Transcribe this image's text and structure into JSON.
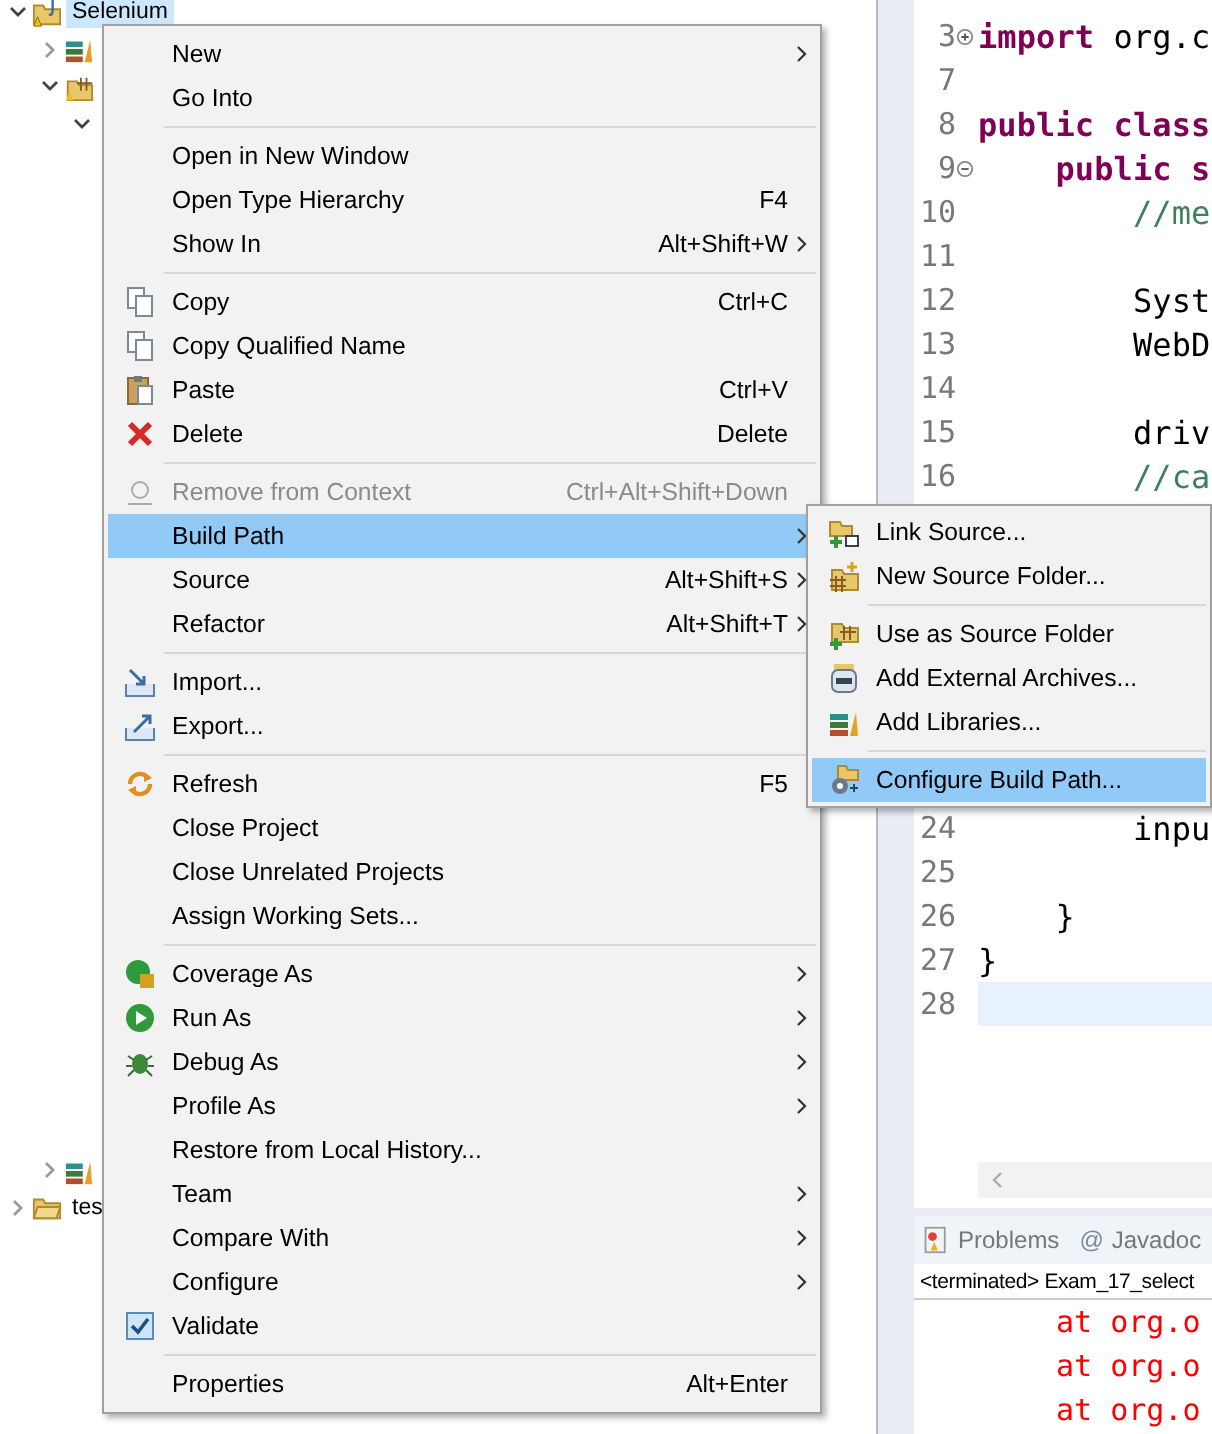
{
  "tree": [
    {
      "kind": "project",
      "label": "Selenium",
      "expanded": true,
      "selected": true,
      "children": [
        {
          "kind": "library",
          "expanded": false,
          "selected": false
        },
        {
          "kind": "package",
          "expanded": true,
          "selected": false,
          "children": [
            {
              "expanded": true,
              "selected": false
            }
          ]
        },
        {
          "kind": "library",
          "expanded": false,
          "selected": false
        }
      ]
    },
    {
      "kind": "folder",
      "label": "tes",
      "expanded": false,
      "selected": false
    }
  ],
  "editor": {
    "lines": [
      {
        "number": "3",
        "fold_expanded": false,
        "tokens": [
          {
            "kind": "keyword",
            "text": "import"
          },
          {
            "kind": "plain",
            "text": " org.c"
          }
        ]
      },
      {
        "number": "7"
      },
      {
        "number": "8",
        "tokens": [
          {
            "kind": "keyword",
            "text": "public class"
          }
        ]
      },
      {
        "number": "9",
        "fold_expanded": true,
        "tokens": [
          {
            "kind": "keyword",
            "text": "    public s"
          }
        ]
      },
      {
        "number": "10",
        "tokens": [
          {
            "kind": "comment",
            "text": "        //me"
          }
        ]
      },
      {
        "number": "11"
      },
      {
        "number": "12",
        "tokens": [
          {
            "kind": "plain",
            "text": "        Syst"
          }
        ]
      },
      {
        "number": "13",
        "tokens": [
          {
            "kind": "plain",
            "text": "        WebD"
          }
        ]
      },
      {
        "number": "14"
      },
      {
        "number": "15",
        "tokens": [
          {
            "kind": "plain",
            "text": "        driv"
          }
        ]
      },
      {
        "number": "16",
        "tokens": [
          {
            "kind": "comment",
            "text": "        //ca"
          }
        ]
      },
      {
        "number": "24",
        "tokens": [
          {
            "kind": "plain",
            "text": "        inpu"
          }
        ]
      },
      {
        "number": "25"
      },
      {
        "number": "26",
        "tokens": [
          {
            "kind": "plain",
            "text": "    }"
          }
        ]
      },
      {
        "number": "27",
        "tokens": [
          {
            "kind": "plain",
            "text": "}"
          }
        ]
      },
      {
        "number": "28",
        "current": true
      }
    ]
  },
  "bottom_panel": {
    "tabs": [
      {
        "kind": "problems",
        "label": "Problems"
      },
      {
        "kind": "glyph",
        "glyph": "@",
        "label": "Javadoc"
      }
    ],
    "console_header": "<terminated> Exam_17_select",
    "console_lines": [
      "at org.o",
      "at org.o",
      "at org.o"
    ]
  },
  "context_menu": {
    "groups": [
      {
        "items": [
          {
            "kind": "command",
            "label": "New",
            "submenu": true,
            "disabled": false,
            "selected": false
          },
          {
            "kind": "command",
            "label": "Go Into",
            "submenu": false,
            "disabled": false,
            "selected": false
          }
        ]
      },
      {
        "items": [
          {
            "kind": "command",
            "label": "Open in New Window",
            "submenu": false,
            "disabled": false,
            "selected": false
          },
          {
            "kind": "command",
            "label": "Open Type Hierarchy",
            "shortcut": "F4",
            "submenu": false,
            "disabled": false,
            "selected": false
          },
          {
            "kind": "command",
            "label": "Show In",
            "shortcut": "Alt+Shift+W",
            "submenu": true,
            "disabled": false,
            "selected": false
          }
        ]
      },
      {
        "items": [
          {
            "kind": "command",
            "label": "Copy",
            "shortcut": "Ctrl+C",
            "submenu": false,
            "disabled": false,
            "selected": false
          },
          {
            "kind": "command",
            "label": "Copy Qualified Name",
            "submenu": false,
            "disabled": false,
            "selected": false
          },
          {
            "kind": "command",
            "label": "Paste",
            "shortcut": "Ctrl+V",
            "submenu": false,
            "disabled": false,
            "selected": false
          },
          {
            "kind": "command",
            "label": "Delete",
            "shortcut": "Delete",
            "submenu": false,
            "disabled": false,
            "selected": false
          }
        ]
      },
      {
        "items": [
          {
            "kind": "command",
            "label": "Remove from Context",
            "shortcut": "Ctrl+Alt+Shift+Down",
            "submenu": false,
            "disabled": true,
            "selected": false
          },
          {
            "kind": "command",
            "label": "Build Path",
            "submenu": true,
            "disabled": false,
            "selected": true
          },
          {
            "kind": "command",
            "label": "Source",
            "shortcut": "Alt+Shift+S",
            "submenu": true,
            "disabled": false,
            "selected": false
          },
          {
            "kind": "command",
            "label": "Refactor",
            "shortcut": "Alt+Shift+T",
            "submenu": true,
            "disabled": false,
            "selected": false
          }
        ]
      },
      {
        "items": [
          {
            "kind": "command",
            "label": "Import...",
            "submenu": false,
            "disabled": false,
            "selected": false
          },
          {
            "kind": "command",
            "label": "Export...",
            "submenu": false,
            "disabled": false,
            "selected": false
          }
        ]
      },
      {
        "items": [
          {
            "kind": "command",
            "label": "Refresh",
            "shortcut": "F5",
            "submenu": false,
            "disabled": false,
            "selected": false
          },
          {
            "kind": "command",
            "label": "Close Project",
            "submenu": false,
            "disabled": false,
            "selected": false
          },
          {
            "kind": "command",
            "label": "Close Unrelated Projects",
            "submenu": false,
            "disabled": false,
            "selected": false
          },
          {
            "kind": "command",
            "label": "Assign Working Sets...",
            "submenu": false,
            "disabled": false,
            "selected": false
          }
        ]
      },
      {
        "items": [
          {
            "kind": "command",
            "label": "Coverage As",
            "submenu": true,
            "disabled": false,
            "selected": false
          },
          {
            "kind": "command",
            "label": "Run As",
            "submenu": true,
            "disabled": false,
            "selected": false
          },
          {
            "kind": "command",
            "label": "Debug As",
            "submenu": true,
            "disabled": false,
            "selected": false
          },
          {
            "kind": "command",
            "label": "Profile As",
            "submenu": true,
            "disabled": false,
            "selected": false
          },
          {
            "kind": "command",
            "label": "Restore from Local History...",
            "submenu": false,
            "disabled": false,
            "selected": false
          },
          {
            "kind": "command",
            "label": "Team",
            "submenu": true,
            "disabled": false,
            "selected": false
          },
          {
            "kind": "command",
            "label": "Compare With",
            "submenu": true,
            "disabled": false,
            "selected": false
          },
          {
            "kind": "command",
            "label": "Configure",
            "submenu": true,
            "disabled": false,
            "selected": false
          },
          {
            "kind": "check",
            "label": "Validate",
            "checked": true,
            "submenu": false,
            "disabled": false,
            "selected": false
          }
        ]
      },
      {
        "items": [
          {
            "kind": "command",
            "label": "Properties",
            "shortcut": "Alt+Enter",
            "submenu": false,
            "disabled": false,
            "selected": false
          }
        ]
      }
    ]
  },
  "build_path_menu": {
    "groups": [
      {
        "items": [
          {
            "kind": "command",
            "label": "Link Source...",
            "submenu": false,
            "disabled": false,
            "selected": false
          },
          {
            "kind": "command",
            "label": "New Source Folder...",
            "submenu": false,
            "disabled": false,
            "selected": false
          }
        ]
      },
      {
        "items": [
          {
            "kind": "command",
            "label": "Use as Source Folder",
            "submenu": false,
            "disabled": false,
            "selected": false
          },
          {
            "kind": "command",
            "label": "Add External Archives...",
            "submenu": false,
            "disabled": false,
            "selected": false
          },
          {
            "kind": "command",
            "label": "Add Libraries...",
            "submenu": false,
            "disabled": false,
            "selected": false
          }
        ]
      },
      {
        "items": [
          {
            "kind": "command",
            "label": "Configure Build Path...",
            "submenu": false,
            "disabled": false,
            "selected": true
          }
        ]
      }
    ]
  }
}
